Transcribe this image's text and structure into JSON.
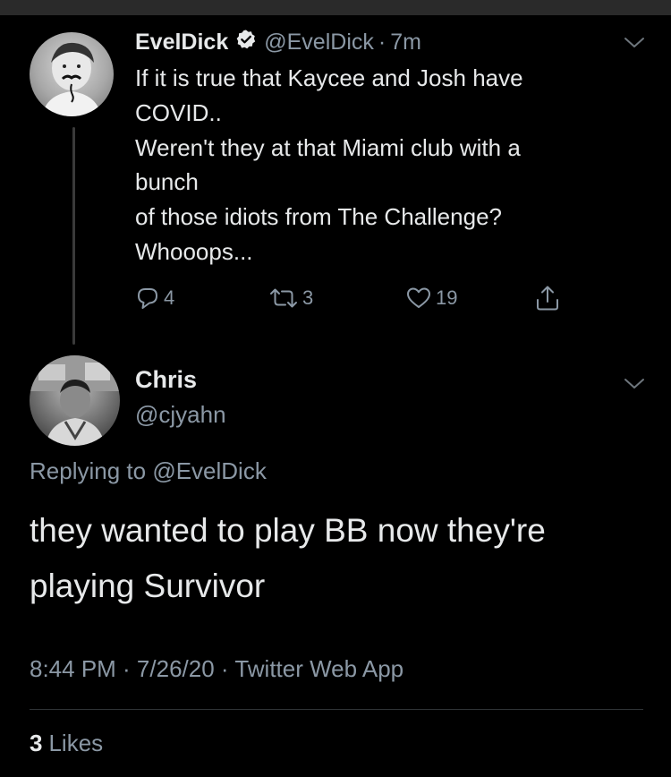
{
  "parent_tweet": {
    "display_name": "EvelDick",
    "verified": true,
    "handle": "@EvelDick",
    "separator": "·",
    "time": "7m",
    "text_lines": [
      "If it is true that Kaycee and Josh have",
      "COVID..",
      "Weren't they at that Miami club with a",
      "bunch",
      "of those idiots from The Challenge?",
      "Whooops..."
    ],
    "reply_count": "4",
    "retweet_count": "3",
    "like_count": "19",
    "icons": {
      "reply": "reply-icon",
      "retweet": "retweet-icon",
      "like": "heart-icon",
      "share": "share-icon",
      "menu": "chevron-down-icon",
      "verified": "verified-badge-icon"
    }
  },
  "reply_tweet": {
    "display_name": "Chris",
    "handle": "@cjyahn",
    "replying_prefix": "Replying to",
    "replying_to": "@EvelDick",
    "text_lines": [
      "they wanted to play BB now they're",
      "playing Survivor"
    ],
    "meta": "8:44 PM · 7/26/20 · Twitter Web App",
    "likes_count": "3",
    "likes_label": "Likes"
  },
  "colors": {
    "background": "#000000",
    "primary_text": "#e7e9ea",
    "secondary_text": "#8b98a5",
    "divider": "#2f3336"
  }
}
